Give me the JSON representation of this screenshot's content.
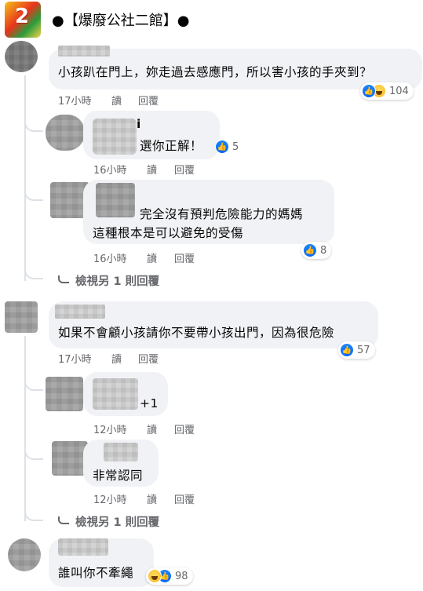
{
  "header": {
    "title": "●【爆廢公社二館】●",
    "logo_text": "2"
  },
  "comments": [
    {
      "text": "小孩趴在門上，妳走過去感應門，所以害小孩的手夾到？",
      "time": "17小時",
      "read": "讀",
      "reply": "回覆",
      "reactions": {
        "count": "104",
        "icons": [
          "like-icon",
          "haha-icon"
        ]
      },
      "replies": [
        {
          "name_fragment": "i",
          "text": "選你正解！",
          "time": "16小時",
          "read": "讀",
          "reply": "回覆",
          "reactions": {
            "count": "5",
            "icons": [
              "like-icon"
            ]
          }
        },
        {
          "text_line1": "完全沒有預判危險能力的媽媽",
          "text_line2": "這種根本是可以避免的受傷",
          "time": "16小時",
          "read": "讀",
          "reply": "回覆",
          "reactions": {
            "count": "8",
            "icons": [
              "like-icon"
            ]
          }
        }
      ],
      "view_more": "檢視另 1 則回覆"
    },
    {
      "text": "如果不會顧小孩請你不要帶小孩出門，因為很危險",
      "time": "17小時",
      "read": "讀",
      "reply": "回覆",
      "reactions": {
        "count": "57",
        "icons": [
          "like-icon"
        ]
      },
      "replies": [
        {
          "text": "+1",
          "time": "12小時",
          "read": "讀",
          "reply": "回覆"
        },
        {
          "text": "非常認同",
          "time": "12小時",
          "read": "讀",
          "reply": "回覆"
        }
      ],
      "view_more": "檢視另 1 則回覆"
    },
    {
      "text": "誰叫你不牽繩",
      "reactions": {
        "count": "98",
        "icons": [
          "haha-icon",
          "like-icon"
        ]
      }
    }
  ],
  "colors": {
    "like_blue": "#0866ff",
    "meta_gray": "#65676b",
    "bubble_bg": "#f0f2f5"
  }
}
